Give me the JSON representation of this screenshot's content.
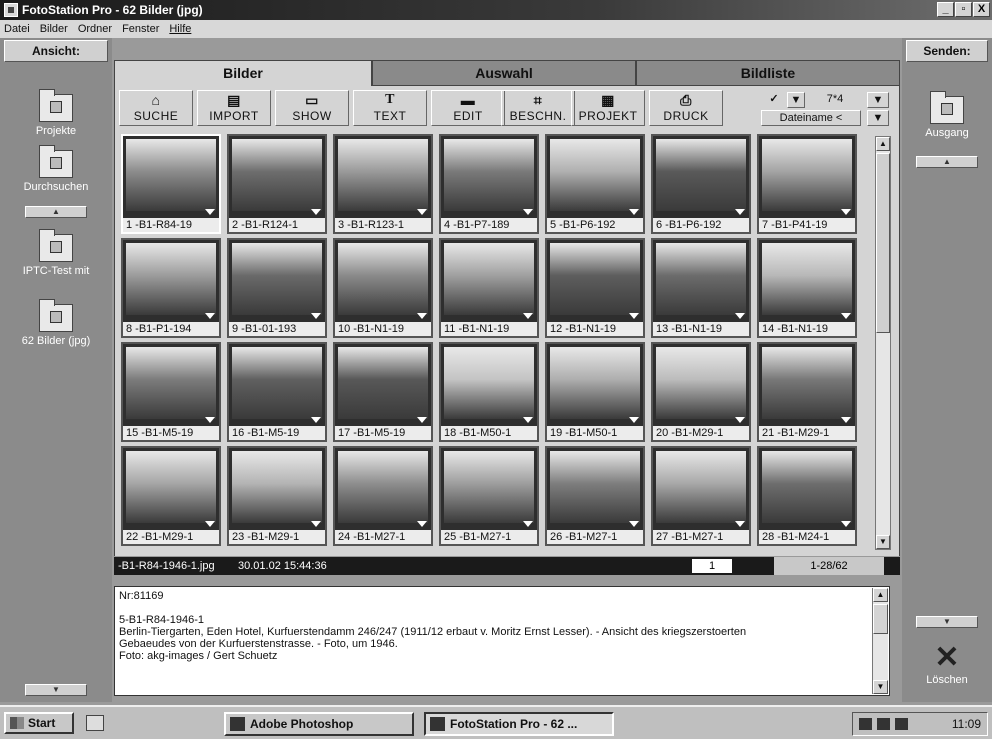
{
  "window": {
    "title": "FotoStation Pro - 62 Bilder (jpg)",
    "controls": [
      "_",
      "̹",
      "X"
    ]
  },
  "menu": [
    "Datei",
    "Bilder",
    "Ordner",
    "Fenster",
    "Hilfe"
  ],
  "left_panel": {
    "header": "Ansicht:",
    "folders": [
      {
        "label": "Projekte",
        "icon": "projects-folder-icon"
      },
      {
        "label": "Durchsuchen",
        "icon": "browse-icon"
      },
      {
        "label": "IPTC-Test mit",
        "icon": "folder-shortcut-icon"
      },
      {
        "label": "62 Bilder (jpg)",
        "icon": "folder-images-icon"
      }
    ]
  },
  "tabs": [
    {
      "label": "Bilder",
      "active": true
    },
    {
      "label": "Auswahl",
      "active": false
    },
    {
      "label": "Bildliste",
      "active": false
    }
  ],
  "toolbar": {
    "buttons": [
      {
        "label": "SUCHE",
        "glyph": "⌂",
        "icon": "binoculars-icon"
      },
      {
        "label": "IMPORT",
        "glyph": "▤",
        "icon": "import-icon"
      },
      {
        "label": "SHOW",
        "glyph": "▭",
        "icon": "slideshow-icon"
      },
      {
        "label": "TEXT",
        "glyph": "T",
        "icon": "text-icon"
      },
      {
        "label": "EDIT",
        "glyph": "▬",
        "icon": "edit-icon"
      },
      {
        "label": "BESCHN.",
        "glyph": "⌗",
        "icon": "crop-icon"
      },
      {
        "label": "PROJEKT",
        "glyph": "▦",
        "icon": "project-icon"
      },
      {
        "label": "DRUCK",
        "glyph": "⎙",
        "icon": "print-icon"
      }
    ],
    "check": "✓",
    "grid_size": "7*4",
    "sort_label": "Dateiname <"
  },
  "thumbnails": [
    {
      "caption": "1 -B1-R84-19",
      "tone": "#8c8c8c"
    },
    {
      "caption": "2 -B1-R124-1",
      "tone": "#6e6e6e"
    },
    {
      "caption": "3 -B1-R123-1",
      "tone": "#9a9a9a"
    },
    {
      "caption": "4 -B1-P7-189",
      "tone": "#7a7a7a"
    },
    {
      "caption": "5 -B1-P6-192",
      "tone": "#b0b0b0"
    },
    {
      "caption": "6 -B1-P6-192",
      "tone": "#5a5a5a"
    },
    {
      "caption": "7 -B1-P41-19",
      "tone": "#a4a4a4"
    },
    {
      "caption": "8 -B1-P1-194",
      "tone": "#9c9c9c"
    },
    {
      "caption": "9 -B1-01-193",
      "tone": "#6a6a6a"
    },
    {
      "caption": "10 -B1-N1-19",
      "tone": "#8a8a8a"
    },
    {
      "caption": "11 -B1-N1-19",
      "tone": "#a0a0a0"
    },
    {
      "caption": "12 -B1-N1-19",
      "tone": "#5e5e5e"
    },
    {
      "caption": "13 -B1-N1-19",
      "tone": "#6c6c6c"
    },
    {
      "caption": "14 -B1-N1-19",
      "tone": "#b8b8b8"
    },
    {
      "caption": "15 -B1-M5-19",
      "tone": "#7c7c7c"
    },
    {
      "caption": "16 -B1-M5-19",
      "tone": "#606060"
    },
    {
      "caption": "17 -B1-M5-19",
      "tone": "#585858"
    },
    {
      "caption": "18 -B1-M50-1",
      "tone": "#c4c4c4"
    },
    {
      "caption": "19 -B1-M50-1",
      "tone": "#aeaeae"
    },
    {
      "caption": "20 -B1-M29-1",
      "tone": "#bcbcbc"
    },
    {
      "caption": "21 -B1-M29-1",
      "tone": "#787878"
    },
    {
      "caption": "22 -B1-M29-1",
      "tone": "#a6a6a6"
    },
    {
      "caption": "23 -B1-M29-1",
      "tone": "#b4b4b4"
    },
    {
      "caption": "24 -B1-M27-1",
      "tone": "#8e8e8e"
    },
    {
      "caption": "25 -B1-M27-1",
      "tone": "#9e9e9e"
    },
    {
      "caption": "26 -B1-M27-1",
      "tone": "#7e7e7e"
    },
    {
      "caption": "27 -B1-M27-1",
      "tone": "#a8a8a8"
    },
    {
      "caption": "28 -B1-M24-1",
      "tone": "#6e6e6e"
    }
  ],
  "status": {
    "file": "-B1-R84-1946-1.jpg",
    "date": "30.01.02 15:44:36",
    "page": "1",
    "range": "1-28/62"
  },
  "info": {
    "text": "Nr:81169\n\n5-B1-R84-1946-1\nBerlin-Tiergarten, Eden Hotel, Kurfuerstendamm 246/247 (1911/12 erbaut v. Moritz Ernst Lesser). - Ansicht des kriegszerstoerten\nGebaeudes von der Kurfuerstenstrasse. - Foto, um 1946.\nFoto: akg-images / Gert Schuetz"
  },
  "right_panel": {
    "header": "Senden:",
    "folder": "Ausgang",
    "delete_label": "Löschen"
  },
  "taskbar": {
    "start": "Start",
    "items": [
      {
        "label": "Adobe Photoshop",
        "active": false
      },
      {
        "label": "FotoStation Pro - 62 ...",
        "active": true
      }
    ],
    "clock": "11:09"
  }
}
